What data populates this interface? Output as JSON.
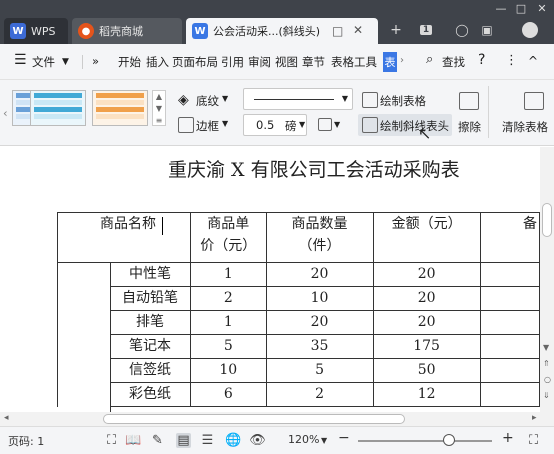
{
  "titlebar": {
    "tabs": [
      {
        "label": "WPS",
        "icon": "W"
      },
      {
        "label": "稻壳商城",
        "icon": "稻"
      },
      {
        "label": "公会活动采...(斜线头)",
        "icon": "W"
      }
    ],
    "new_tab": "+",
    "tab_count": "1"
  },
  "menubar": {
    "menu_label": "文件",
    "more": "»",
    "items": [
      "开始",
      "插入",
      "页面布局",
      "引用",
      "审阅",
      "视图",
      "章节",
      "表格工具",
      "表"
    ],
    "search_label": "查找",
    "help": "?",
    "more_dots": "⋮",
    "collapse": "^"
  },
  "ribbon": {
    "shading_label": "底纹",
    "border_label": "边框",
    "line_width_value": "0.5",
    "line_width_unit": "磅",
    "draw_table_label": "绘制表格",
    "draw_diagonal_label": "绘制斜线表头",
    "erase_label": "擦除",
    "clear_table_label": "清除表格"
  },
  "document": {
    "title": "重庆渝 X 有限公司工会活动采购表",
    "headers": [
      "商品名称",
      "商品单价（元）",
      "商品数量（件）",
      "金额（元）",
      "备"
    ],
    "header_lines": [
      [
        "商品名称"
      ],
      [
        "商品单",
        "价（元）"
      ],
      [
        "商品数量",
        "（件）"
      ],
      [
        "金额（元）"
      ],
      [
        "备"
      ]
    ],
    "rows": [
      [
        "中性笔",
        "1",
        "20",
        "20"
      ],
      [
        "自动铅笔",
        "2",
        "10",
        "20"
      ],
      [
        "排笔",
        "1",
        "20",
        "20"
      ],
      [
        "笔记本",
        "5",
        "35",
        "175"
      ],
      [
        "信签纸",
        "10",
        "5",
        "50"
      ],
      [
        "彩色纸",
        "6",
        "2",
        "12"
      ]
    ]
  },
  "statusbar": {
    "page_label": "页码: 1",
    "zoom": "120%",
    "zoom_fraction": 0.68,
    "minus": "−",
    "plus": "+"
  }
}
